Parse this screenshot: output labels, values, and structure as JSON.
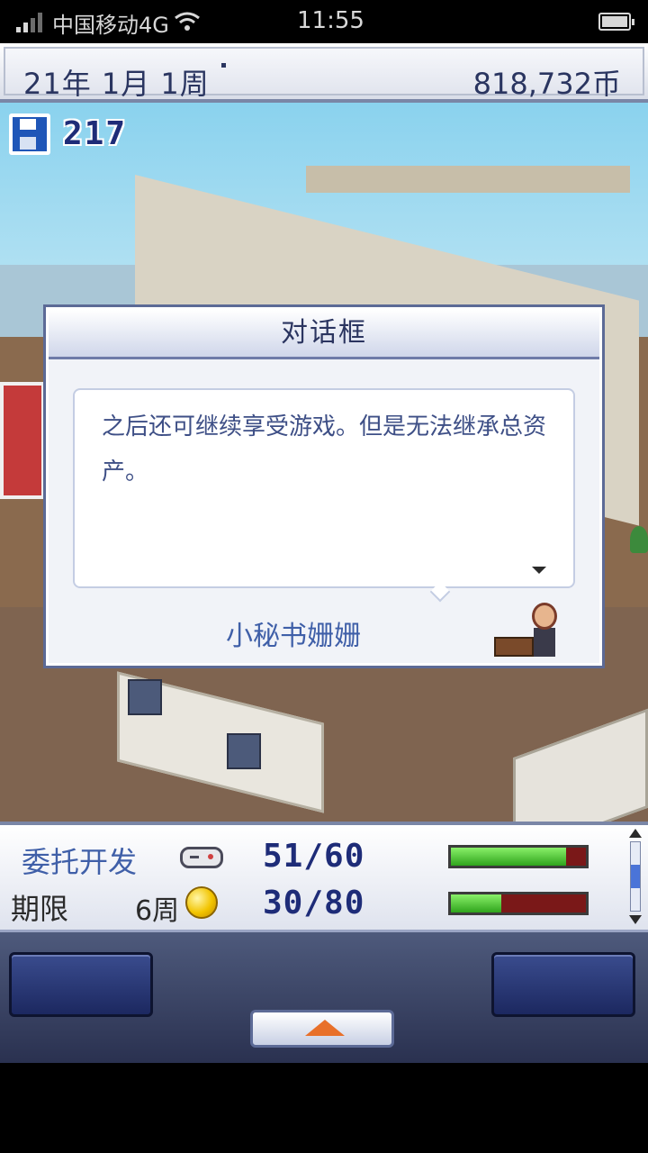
{
  "status_bar": {
    "carrier": "中国移动4G",
    "time": "11:55"
  },
  "top_bar": {
    "date": "21年 1月 1周",
    "money": "818,732币"
  },
  "save_counter": "217",
  "dialog": {
    "title": "对话框",
    "message": "之后还可继续享受游戏。但是无法继承总资产。",
    "speaker": "小秘书姗姗"
  },
  "project_panel": {
    "label": "委托开发",
    "fraction_1": "51/60",
    "progress_1": 0.85,
    "deadline_label": "期限",
    "deadline_value": "6周",
    "fraction_2": "30/80",
    "progress_2": 0.375
  },
  "colors": {
    "accent_blue": "#3f5fa8",
    "bar_green": "#2fa41c",
    "bar_red": "#7a1818",
    "menu_arrow": "#e8702a"
  }
}
